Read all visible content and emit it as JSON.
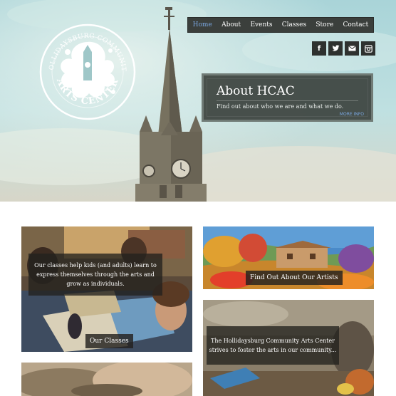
{
  "nav": {
    "items": [
      {
        "label": "Home",
        "active": true
      },
      {
        "label": "About",
        "active": false
      },
      {
        "label": "Events",
        "active": false
      },
      {
        "label": "Classes",
        "active": false
      },
      {
        "label": "Store",
        "active": false
      },
      {
        "label": "Contact",
        "active": false
      }
    ]
  },
  "social": [
    "facebook-icon",
    "twitter-icon",
    "email-icon",
    "instagram-icon"
  ],
  "logo": {
    "top_text": "HOLLIDAYSBURG COMMUNITY",
    "bottom_text": "ARTS CENTER"
  },
  "about": {
    "title": "About HCAC",
    "subtitle": "Find out about who we are and what we do.",
    "more": "MORE INFO"
  },
  "cards": {
    "classes": {
      "caption": "Our classes help kids (and adults) learn to express themselves through the arts and grow as individuals.",
      "label": "Our Classes"
    },
    "artists": {
      "label": "Find Out About Our Artists"
    },
    "community": {
      "caption": "The Hollidaysburg Community Arts Center strives to foster the arts in our community..."
    }
  },
  "colors": {
    "nav_bg": "#3b3f3c",
    "nav_active": "#7aa7e0",
    "link": "#7aa7e0"
  }
}
